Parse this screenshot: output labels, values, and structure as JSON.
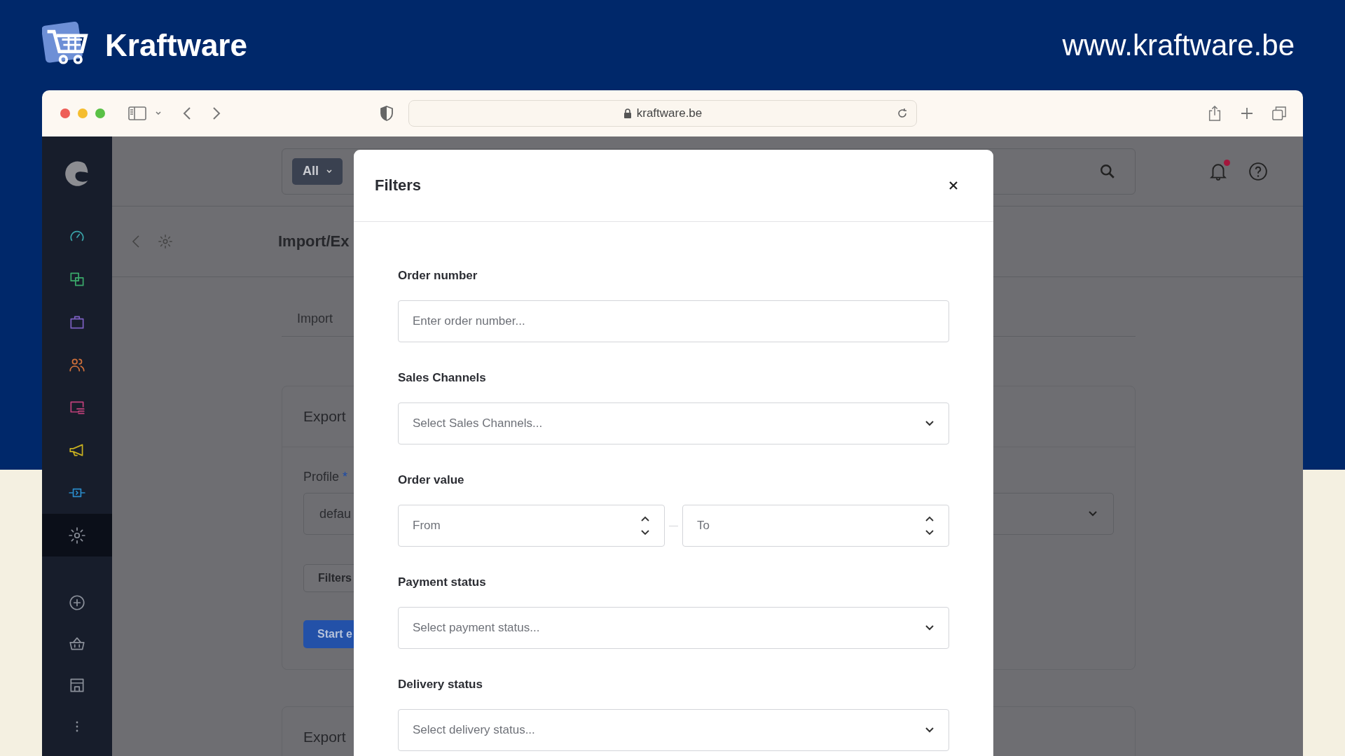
{
  "brand": {
    "name": "Kraftware",
    "url": "www.kraftware.be"
  },
  "browser": {
    "address": "kraftware.be"
  },
  "sidebar": {
    "items": [
      {
        "selected": false,
        "color": "#3aa3a8"
      },
      {
        "selected": false,
        "color": "#3aa86a"
      },
      {
        "selected": false,
        "color": "#7b5fc0"
      },
      {
        "selected": false,
        "color": "#d0703a"
      },
      {
        "selected": false,
        "color": "#c0407a"
      },
      {
        "selected": false,
        "color": "#c8b020"
      },
      {
        "selected": false,
        "color": "#2a8ac8"
      },
      {
        "selected": true,
        "color": "#8a8f99"
      }
    ]
  },
  "topbar": {
    "search_scope": "All",
    "notification": true
  },
  "page": {
    "title": "Import/Ex",
    "tabs": [
      {
        "label": "Import",
        "selected": false
      }
    ],
    "card": {
      "title": "Export",
      "profile_label": "Profile",
      "required_mark": "*",
      "profile_value": "defau",
      "filters_button": "Filters",
      "start_button": "Start e"
    },
    "second_card": {
      "title": "Export"
    }
  },
  "modal": {
    "title": "Filters",
    "fields": [
      {
        "kind": "text",
        "label": "Order number",
        "placeholder": "Enter order number..."
      },
      {
        "kind": "select",
        "label": "Sales Channels",
        "placeholder": "Select Sales Channels..."
      },
      {
        "kind": "range",
        "label": "Order value",
        "from_placeholder": "From",
        "to_placeholder": "To"
      },
      {
        "kind": "select",
        "label": "Payment status",
        "placeholder": "Select payment status..."
      },
      {
        "kind": "select",
        "label": "Delivery status",
        "placeholder": "Select delivery status..."
      }
    ]
  }
}
